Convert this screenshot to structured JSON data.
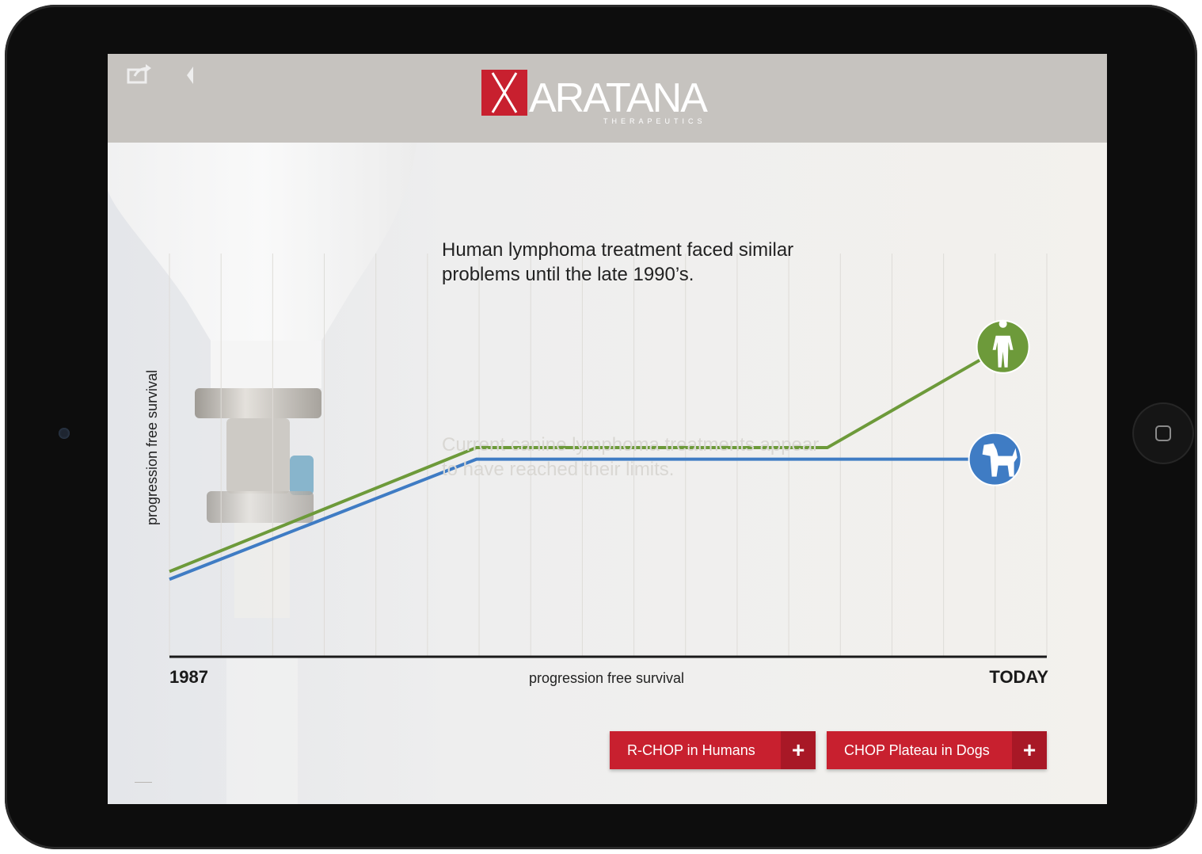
{
  "header": {
    "logo_word": "ARATANA",
    "logo_sub": "THERAPEUTICS"
  },
  "content": {
    "message_primary": "Human lymphoma treatment faced similar problems until the late 1990’s.",
    "message_secondary": "Current canine lymphoma treatments appear to have reached their limits."
  },
  "chart_data": {
    "type": "line",
    "xlabel": "progression free survival",
    "ylabel": "progression free survival",
    "x_start_label": "1987",
    "x_end_label": "TODAY",
    "x": [
      0,
      0.35,
      0.75,
      0.95
    ],
    "series": [
      {
        "color": "#6d9a3a",
        "y": [
          0.22,
          0.54,
          0.54,
          0.8
        ],
        "endpoint_icon": "human-figure-icon"
      },
      {
        "color": "#3f7cc4",
        "y": [
          0.2,
          0.51,
          0.51,
          0.51
        ],
        "endpoint_icon": "dog-icon"
      }
    ],
    "grid": true
  },
  "buttons": [
    {
      "label": "R-CHOP in Humans",
      "icon": "+"
    },
    {
      "label": "CHOP Plateau in Dogs",
      "icon": "+"
    }
  ],
  "colors": {
    "brand_red": "#c8202f",
    "green_series": "#6d9a3a",
    "blue_series": "#3f7cc4",
    "header_bar": "#c6c3bf"
  }
}
